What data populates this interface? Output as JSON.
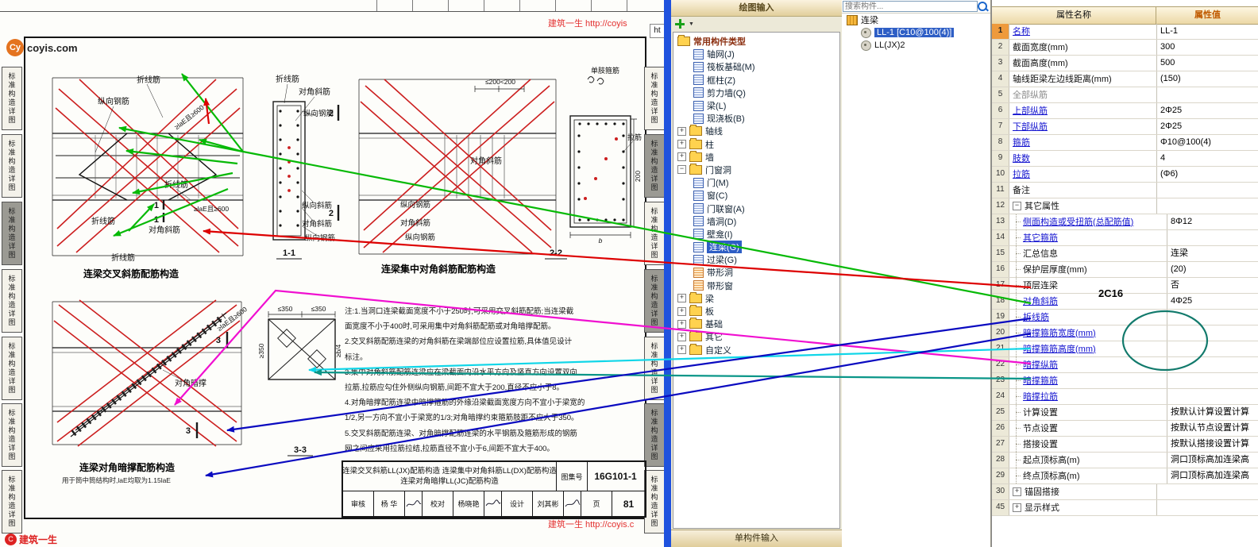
{
  "ui": {
    "plus": "+",
    "minus": "−"
  },
  "doc": {
    "side_tab": "标准构造详图",
    "logo": {
      "mark": "Cy",
      "site": "coyis.com"
    },
    "watermark_top": "建筑一生 http://coyis",
    "watermark_bottom": "建筑一生 http://coyis.c",
    "watermark_logo": "建筑一生",
    "ht_box": "ht",
    "d1": {
      "title": "连梁交叉斜筋配筋构造",
      "lbl_zhexian_top": "折线筋",
      "lbl_zongxiang": "纵向钢筋",
      "lbl_zhexian_mid": "折线筋",
      "lbl_duijiao": "对角斜筋",
      "lbl_zhexian_left": "折线筋",
      "lbl_zhexian_bot": "折线筋",
      "dim_diag": "≥laE且≥600",
      "dim_horiz": "≥laE且≥600",
      "cut_mark": "1"
    },
    "d2": {
      "label": "1-1",
      "lbl_zhexian": "折线筋",
      "lbl_duijiao": "对角斜筋",
      "lbl_zong": "纵向钢筋",
      "lbl_zongxie": "纵向斜筋",
      "lbl_duijiao2": "对角斜筋",
      "lbl_zong2": "纵向钢筋"
    },
    "d3": {
      "title": "连梁集中对角斜筋配筋构造",
      "label": "2-2",
      "dim_top": "≤200<200",
      "lbl_danzhi": "单肢箍筋",
      "lbl_lajin": "拉筋",
      "lbl_duijiao": "对角斜筋",
      "lbl_zong1": "纵向钢筋",
      "lbl_duijiao2": "对角斜筋",
      "lbl_zong2": "纵向钢筋",
      "dim_200": "200",
      "dim_b": "b",
      "cut_mark": "2"
    },
    "d4": {
      "title": "连梁对角暗撑配筋构造",
      "subtitle": "用于筒中筒结构时,laE均取为1.15laE",
      "lbl_anchen": "对角暗撑",
      "dim_diag": "≥laE且≥600",
      "cut_mark": "3"
    },
    "d5": {
      "label": "3-3",
      "dim_350a": "≤350",
      "dim_350b": "≤350",
      "dim_350c": "≥350",
      "dim_b4": "≥b/4"
    },
    "notes": [
      "注:1.当洞口连梁截面宽度不小于250时,可采用交叉斜筋配筋;当连梁截",
      "面宽度不小于400时,可采用集中对角斜筋配筋或对角暗撑配筋。",
      "2.交叉斜筋配筋连梁的对角斜筋在梁端部位应设置拉筋,具体值见设计",
      "标注。",
      "3.集中对角斜筋配筋连梁应在梁截面内沿水平方向及竖直方向设置双向",
      "拉筋,拉筋应勾住外侧纵向钢筋,间距不宜大于200,直径不应小于8。",
      "4.对角暗撑配筋连梁中暗撑箍筋的外缘沿梁截面宽度方向不宜小于梁宽的",
      "1/2,另一方向不宜小于梁宽的1/3;对角暗撑约束箍筋肢距不应大于350。",
      "5.交叉斜筋配筋连梁、对角暗撑配筋连梁的水平钢筋及箍筋形成的钢筋",
      "网之间应采用拉筋拉结,拉筋直径不宜小于6,间距不宜大于400。"
    ],
    "titleblock": {
      "line1": "连梁交叉斜筋LL(JX)配筋构造  连梁集中对角斜筋LL(DX)配筋构造",
      "line2": "连梁对角暗撑LL(JC)配筋构造",
      "atlas_label": "图集号",
      "atlas_no": "16G101-1",
      "review_label": "审核",
      "review_name": "杨 华",
      "check_label": "校对",
      "check_name": "杨晓艳",
      "design_label": "设计",
      "design_name": "刘其彬",
      "page_label": "页",
      "page_no": "81"
    }
  },
  "draw_panel": {
    "title": "绘图输入",
    "bottom_bar": "单构件输入",
    "tree": [
      "常用构件类型",
      "轴网(J)",
      "筏板基础(M)",
      "框柱(Z)",
      "剪力墙(Q)",
      "梁(L)",
      "现浇板(B)",
      "轴线",
      "柱",
      "墙",
      "门窗洞",
      "门(M)",
      "窗(C)",
      "门联窗(A)",
      "墙洞(D)",
      "壁龛(I)",
      "连梁(G)",
      "过梁(G)",
      "带形洞",
      "带形窗",
      "梁",
      "板",
      "基础",
      "其它",
      "自定义"
    ]
  },
  "component_panel": {
    "search_placeholder": "搜索构件...",
    "root": "连梁",
    "items": [
      "LL-1 [C10@100(4)]",
      "LL(JX)2"
    ]
  },
  "properties": {
    "header": {
      "name": "属性名称",
      "value": "属性值"
    },
    "rows": [
      {
        "n": "1",
        "name": "名称",
        "val": "LL-1"
      },
      {
        "n": "2",
        "name": "截面宽度(mm)",
        "val": "300"
      },
      {
        "n": "3",
        "name": "截面高度(mm)",
        "val": "500"
      },
      {
        "n": "4",
        "name": "轴线距梁左边线距离(mm)",
        "val": "(150)"
      },
      {
        "n": "5",
        "name": "全部纵筋",
        "val": ""
      },
      {
        "n": "6",
        "name": "上部纵筋",
        "val": "2Φ25"
      },
      {
        "n": "7",
        "name": "下部纵筋",
        "val": "2Φ25"
      },
      {
        "n": "8",
        "name": "箍筋",
        "val": "Φ10@100(4)"
      },
      {
        "n": "9",
        "name": "肢数",
        "val": "4"
      },
      {
        "n": "10",
        "name": "拉筋",
        "val": "(Φ6)"
      },
      {
        "n": "11",
        "name": "备注",
        "val": ""
      },
      {
        "n": "12",
        "name": "其它属性",
        "val": ""
      },
      {
        "n": "13",
        "name": "侧面构造或受扭筋(总配筋值)",
        "val": "8Φ12"
      },
      {
        "n": "14",
        "name": "其它箍筋",
        "val": ""
      },
      {
        "n": "15",
        "name": "汇总信息",
        "val": "连梁"
      },
      {
        "n": "16",
        "name": "保护层厚度(mm)",
        "val": "(20)"
      },
      {
        "n": "17",
        "name": "顶层连梁",
        "val": "否"
      },
      {
        "n": "18",
        "name": "对角斜筋",
        "val": "4Φ25"
      },
      {
        "n": "19",
        "name": "折线筋",
        "val": ""
      },
      {
        "n": "20",
        "name": "暗撑箍筋宽度(mm)",
        "val": ""
      },
      {
        "n": "21",
        "name": "暗撑箍筋高度(mm)",
        "val": ""
      },
      {
        "n": "22",
        "name": "暗撑纵筋",
        "val": ""
      },
      {
        "n": "23",
        "name": "暗撑箍筋",
        "val": ""
      },
      {
        "n": "24",
        "name": "暗撑拉筋",
        "val": ""
      },
      {
        "n": "25",
        "name": "计算设置",
        "val": "按默认计算设置计算"
      },
      {
        "n": "26",
        "name": "节点设置",
        "val": "按默认节点设置计算"
      },
      {
        "n": "27",
        "name": "搭接设置",
        "val": "按默认搭接设置计算"
      },
      {
        "n": "28",
        "name": "起点顶标高(m)",
        "val": "洞口顶标高加连梁高"
      },
      {
        "n": "29",
        "name": "终点顶标高(m)",
        "val": "洞口顶标高加连梁高"
      },
      {
        "n": "30",
        "name": "锚固搭接",
        "val": ""
      },
      {
        "n": "45",
        "name": "显示样式",
        "val": ""
      }
    ]
  },
  "annotations": {
    "handnote": "2C16"
  }
}
